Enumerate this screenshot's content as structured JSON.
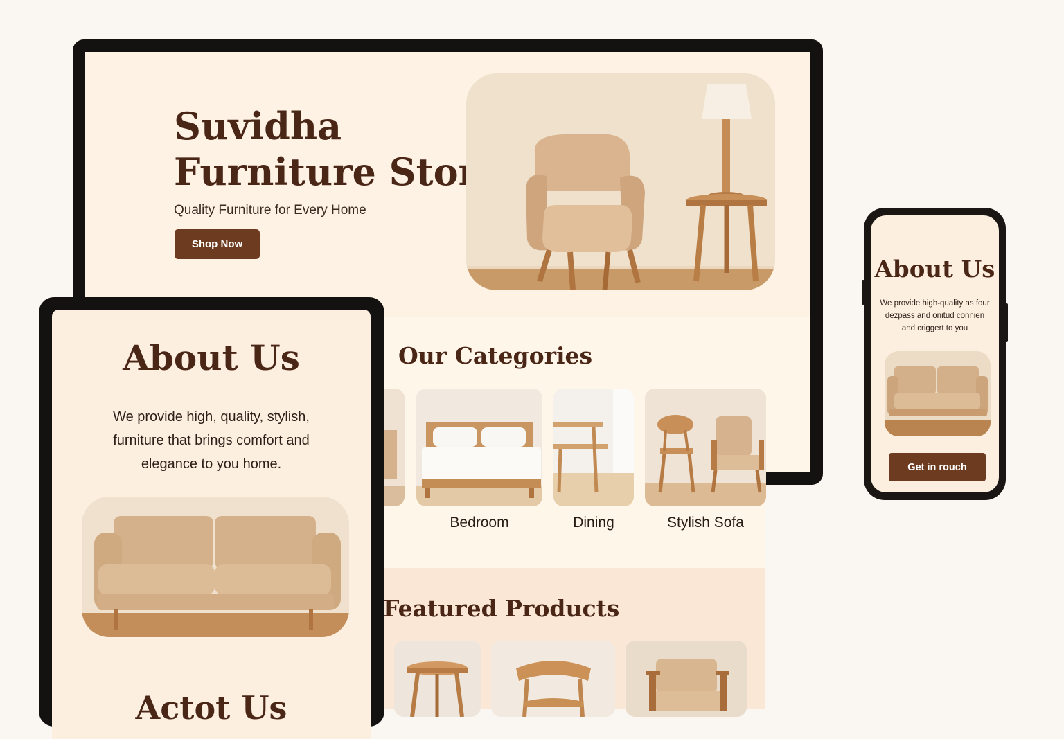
{
  "desktop": {
    "hero": {
      "title_line1": "Suvidha",
      "title_line2": "Furniture Store",
      "subtitle": "Quality Furniture for Every Home",
      "cta_label": "Shop Now"
    },
    "categories": {
      "title": "Our Categories",
      "items": [
        {
          "label": ""
        },
        {
          "label": "Bedroom"
        },
        {
          "label": "Dining"
        },
        {
          "label": "Stylish Sofa"
        }
      ]
    },
    "featured": {
      "title": "Featured Products"
    }
  },
  "tablet": {
    "title": "About Us",
    "body": "We provide high, quality, stylish, furniture that brings comfort and elegance to you home.",
    "title2": "Actot Us"
  },
  "phone": {
    "title": "About Us",
    "body": "We provide high-quality as four dezpass and onitud connien and criggert to you",
    "cta_label": "Get in rouch"
  },
  "colors": {
    "brand_brown": "#6d3b1f",
    "heading_brown": "#4a2616",
    "cream_bg": "#fdf2e4",
    "page_bg": "#faf7f2"
  },
  "icons": [
    "armchair-image",
    "sofa-image",
    "bed-image",
    "dining-table-image",
    "chair-image",
    "side-table-image"
  ]
}
